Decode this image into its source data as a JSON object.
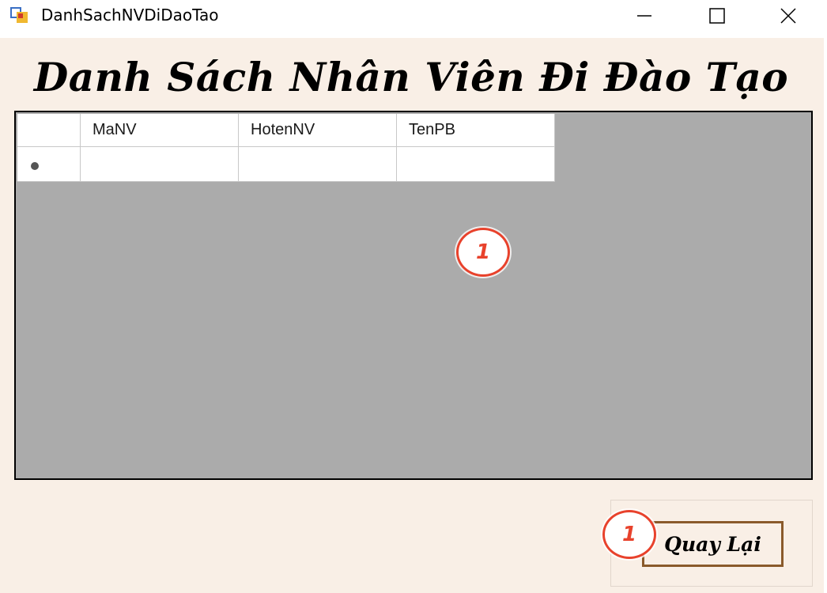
{
  "window": {
    "title": "DanhSachNVDiDaoTao",
    "icons": {
      "app": "app-form-icon",
      "minimize": "minimize-icon",
      "maximize": "maximize-icon",
      "close": "close-icon"
    }
  },
  "heading": "Danh Sách Nhân Viên Đi Đào Tạo",
  "grid": {
    "columns": [
      "MaNV",
      "HotenNV",
      "TenPB"
    ],
    "rows": [
      [
        "",
        "",
        ""
      ]
    ],
    "new_row_indicator": "row-pointer-icon",
    "background": "#ababab"
  },
  "annotations": {
    "grid_marker": "1",
    "button_marker": "1",
    "color": "#e8422c"
  },
  "back_button": {
    "label": "Quay Lại",
    "border_color": "#8a5a2b"
  }
}
